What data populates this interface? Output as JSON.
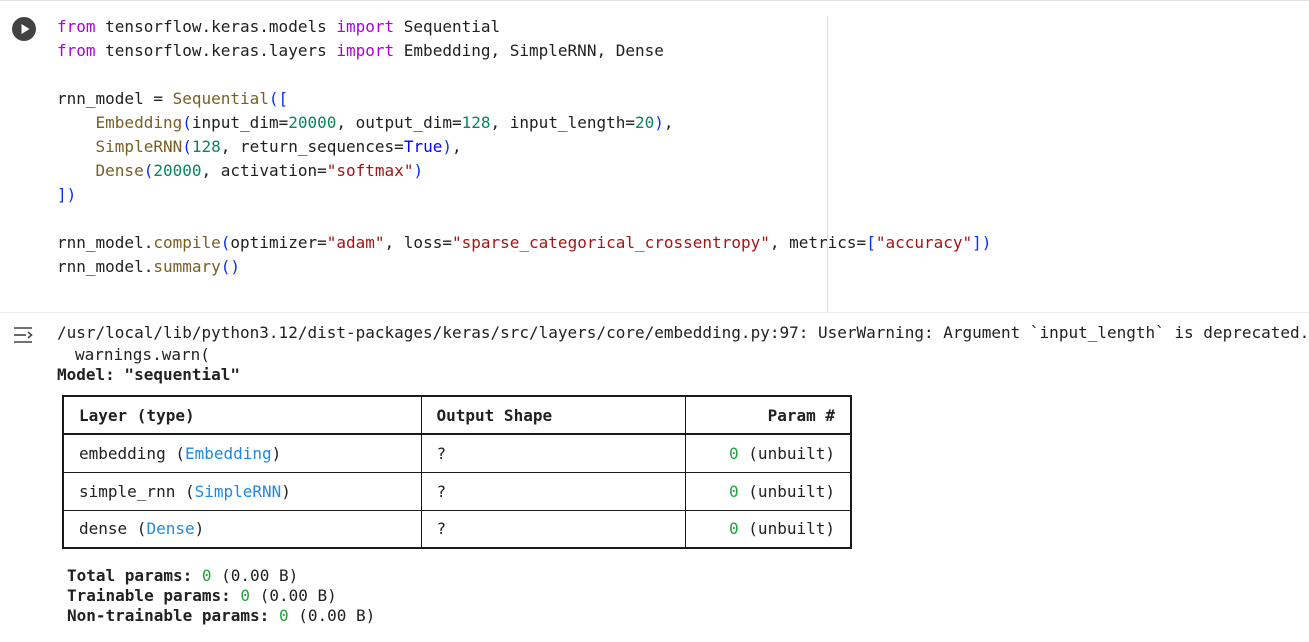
{
  "code": {
    "lines": [
      [
        [
          "kw",
          "from"
        ],
        [
          "t",
          " tensorflow.keras.models "
        ],
        [
          "kw",
          "import"
        ],
        [
          "t",
          " Sequential"
        ]
      ],
      [
        [
          "kw",
          "from"
        ],
        [
          "t",
          " tensorflow.keras.layers "
        ],
        [
          "kw",
          "import"
        ],
        [
          "t",
          " Embedding, SimpleRNN, Dense"
        ]
      ],
      [],
      [
        [
          "t",
          "rnn_model = "
        ],
        [
          "fn",
          "Sequential"
        ],
        [
          "brk",
          "(["
        ]
      ],
      [
        [
          "t",
          "    "
        ],
        [
          "fn",
          "Embedding"
        ],
        [
          "brk",
          "("
        ],
        [
          "t",
          "input_dim="
        ],
        [
          "num",
          "20000"
        ],
        [
          "t",
          ", output_dim="
        ],
        [
          "num",
          "128"
        ],
        [
          "t",
          ", input_length="
        ],
        [
          "num",
          "20"
        ],
        [
          "brk",
          ")"
        ],
        [
          "t",
          ","
        ]
      ],
      [
        [
          "t",
          "    "
        ],
        [
          "fn",
          "SimpleRNN"
        ],
        [
          "brk",
          "("
        ],
        [
          "num",
          "128"
        ],
        [
          "t",
          ", return_sequences="
        ],
        [
          "bool",
          "True"
        ],
        [
          "brk",
          ")"
        ],
        [
          "t",
          ","
        ]
      ],
      [
        [
          "t",
          "    "
        ],
        [
          "fn",
          "Dense"
        ],
        [
          "brk",
          "("
        ],
        [
          "num",
          "20000"
        ],
        [
          "t",
          ", activation="
        ],
        [
          "str",
          "\"softmax\""
        ],
        [
          "brk",
          ")"
        ]
      ],
      [
        [
          "brk",
          "])"
        ]
      ],
      [],
      [
        [
          "t",
          "rnn_model."
        ],
        [
          "fn",
          "compile"
        ],
        [
          "brk",
          "("
        ],
        [
          "t",
          "optimizer="
        ],
        [
          "str",
          "\"adam\""
        ],
        [
          "t",
          ", loss="
        ],
        [
          "str",
          "\"sparse_categorical_crossentropy\""
        ],
        [
          "t",
          ", metrics="
        ],
        [
          "brk",
          "["
        ],
        [
          "str",
          "\"accuracy\""
        ],
        [
          "brk",
          "])"
        ]
      ],
      [
        [
          "t",
          "rnn_model."
        ],
        [
          "fn",
          "summary"
        ],
        [
          "brk",
          "()"
        ]
      ]
    ]
  },
  "output": {
    "warning": "/usr/local/lib/python3.12/dist-packages/keras/src/layers/core/embedding.py:97: UserWarning: Argument `input_length` is deprecated. Just remove it.",
    "warning_call": "warnings.warn(",
    "model_title": "Model: \"sequential\"",
    "table": {
      "headers": [
        "Layer (type)",
        "Output Shape",
        "Param #"
      ],
      "rows": [
        {
          "name": "embedding",
          "type": "Embedding",
          "shape": "?",
          "params": "0",
          "suffix": "(unbuilt)"
        },
        {
          "name": "simple_rnn",
          "type": "SimpleRNN",
          "shape": "?",
          "params": "0",
          "suffix": "(unbuilt)"
        },
        {
          "name": "dense",
          "type": "Dense",
          "shape": "?",
          "params": "0",
          "suffix": "(unbuilt)"
        }
      ]
    },
    "totals": {
      "total_label": "Total params:",
      "total_value": "0",
      "total_size": "(0.00 B)",
      "trainable_label": "Trainable params:",
      "trainable_value": "0",
      "trainable_size": "(0.00 B)",
      "non_trainable_label": "Non-trainable params:",
      "non_trainable_value": "0",
      "non_trainable_size": "(0.00 B)"
    }
  },
  "icons": {
    "run": "play-icon",
    "output": "output-actions-icon"
  },
  "colors": {
    "keyword": "#af00db",
    "number": "#098658",
    "string": "#a31515",
    "function": "#795e26",
    "layer_type": "#1e88e5",
    "param_zero": "#1fa33a"
  }
}
